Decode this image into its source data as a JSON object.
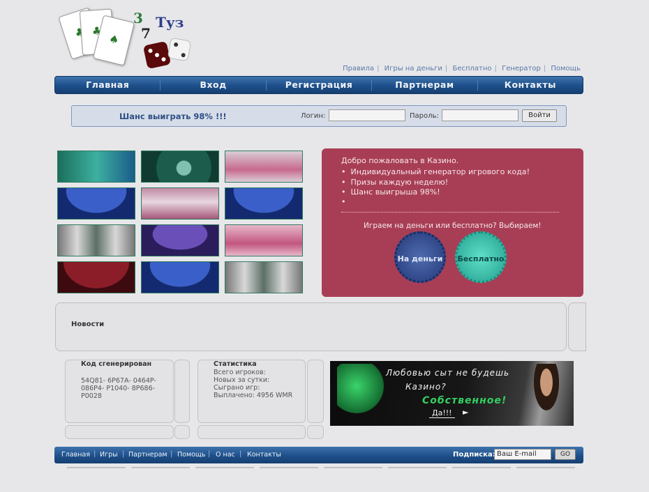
{
  "logo": {
    "num_top": "3",
    "word": "Туз",
    "num_bottom": "7"
  },
  "top_links": [
    "Правила",
    "Игры на деньги",
    "Бесплатно",
    "Генератор",
    "Помощь"
  ],
  "nav": [
    "Главная",
    "Вход",
    "Регистрация",
    "Партнерам",
    "Контакты"
  ],
  "login": {
    "slogan": "Шанс выиграть 98% !!!",
    "login_label": "Логин:",
    "password_label": "Пароль:",
    "button": "Войти"
  },
  "welcome": {
    "title": "Добро пожаловать в Казино.",
    "bullets": [
      "Индивидуальный генератор игрового кода!",
      "Призы каждую неделю!",
      "Шанс выигрыша 98%!"
    ],
    "question": "Играем на деньги или бесплатно? Выбираем!",
    "money_button": "На деньги",
    "free_button": "Бесплатно"
  },
  "news": {
    "title": "Новости"
  },
  "code_panel": {
    "title": "Код сгенерирован",
    "text": "54Q81- 6P67A- 0464P-\n086P4- P1040- 8P686-\nP0028"
  },
  "stats_panel": {
    "title": "Статистика",
    "text": "Всего игроков:\nНовых за сутки:\nСыграно игр:\nВыплачено: 4956 WMR"
  },
  "banner": {
    "line1": "Любовью сыт не будешь",
    "line2": "Казино?",
    "line3": "Собственное!",
    "cta": "Да!!!"
  },
  "footer": {
    "links": [
      "Главная",
      "Игры",
      "Партнерам",
      "Помощь",
      "О нас",
      "Контакты"
    ],
    "subscribe_label": "Подписка:",
    "email_value": "Ваш E-mail",
    "go": "GO"
  },
  "colors": {
    "nav": "#1d4f8a",
    "welcome": "#a83e55",
    "money_badge": "#2e4a8c",
    "free_badge": "#2fb8a3"
  }
}
